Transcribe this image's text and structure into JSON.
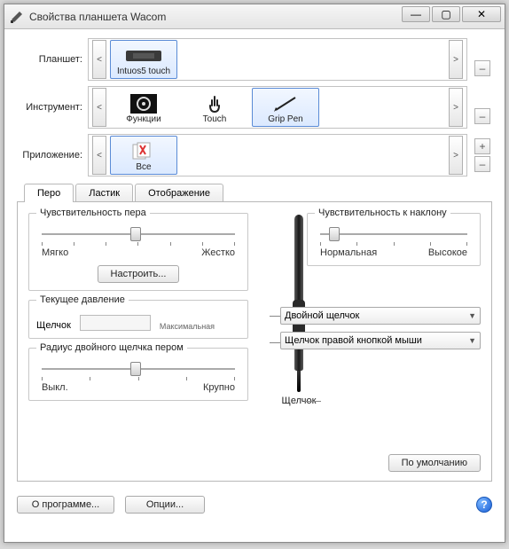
{
  "window": {
    "title": "Свойства планшета Wacom",
    "min": "—",
    "max": "▢",
    "close": "✕"
  },
  "pickers": {
    "tablet_label": "Планшет:",
    "tool_label": "Инструмент:",
    "app_label": "Приложение:",
    "left": "<",
    "right": ">",
    "plus": "+",
    "minus": "–",
    "tablet_items": [
      {
        "label": "Intuos5 touch",
        "selected": true
      }
    ],
    "tool_items": [
      {
        "label": "Функции",
        "selected": false
      },
      {
        "label": "Touch",
        "selected": false
      },
      {
        "label": "Grip Pen",
        "selected": true
      }
    ],
    "app_items": [
      {
        "label": "Все",
        "selected": true
      }
    ]
  },
  "tabs": {
    "items": [
      "Перо",
      "Ластик",
      "Отображение"
    ],
    "active": 0
  },
  "pen_panel": {
    "sensitivity_title": "Чувствительность пера",
    "soft": "Мягко",
    "hard": "Жестко",
    "customize_btn": "Настроить...",
    "pressure_title": "Текущее давление",
    "click": "Щелчок",
    "max": "Максимальная",
    "double_title": "Радиус двойного щелчка пером",
    "off": "Выкл.",
    "large": "Крупно",
    "tilt_title": "Чувствительность к наклону",
    "normal": "Нормальная",
    "high": "Высокое",
    "btn_upper": "Двойной щелчок",
    "btn_lower": "Щелчок правой кнопкой мыши",
    "tip_label": "Щелчок",
    "default_btn": "По умолчанию"
  },
  "footer": {
    "about": "О программе...",
    "options": "Опции...",
    "help": "?"
  }
}
